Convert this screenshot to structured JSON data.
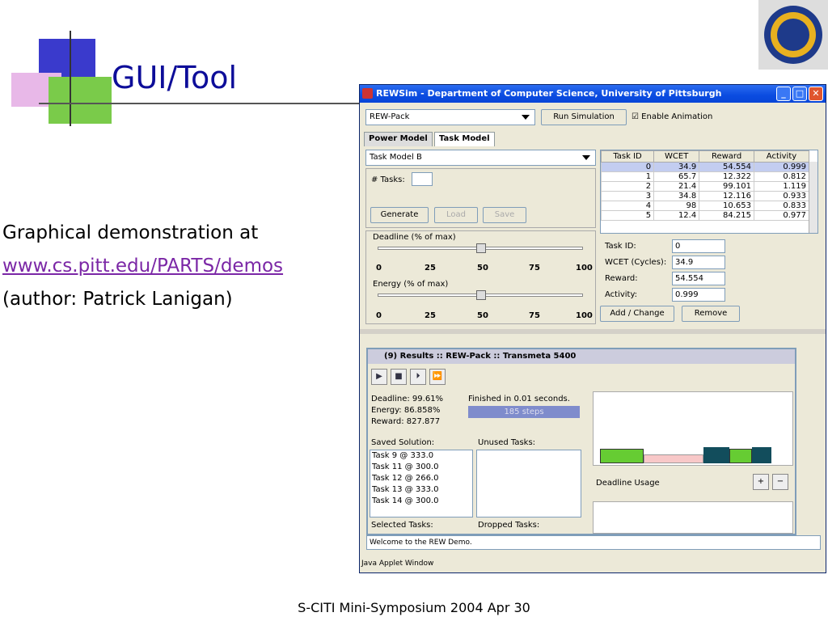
{
  "slide": {
    "title": "GUI/Tool",
    "line1": "Graphical demonstration at",
    "link": "www.cs.pitt.edu/PARTS/demos",
    "line3": "(author: Patrick Lanigan)",
    "footer": "S-CITI Mini-Symposium 2004 Apr 30"
  },
  "window": {
    "title": "REWSim - Department of Computer Science, University of Pittsburgh",
    "combo_value": "REW-Pack",
    "run_button": "Run Simulation",
    "enable_anim": "Enable Animation",
    "tabs": [
      "Power Model",
      "Task Model"
    ],
    "task_model_value": "Task Model B",
    "num_tasks_label": "# Tasks:",
    "generate": "Generate",
    "load": "Load",
    "save": "Save",
    "deadline_label": "Deadline (% of max)",
    "energy_label": "Energy (% of max)",
    "ticks": [
      "0",
      "25",
      "50",
      "75",
      "100"
    ],
    "table": {
      "headers": [
        "Task ID",
        "WCET",
        "Reward",
        "Activity"
      ],
      "rows": [
        [
          "0",
          "34.9",
          "54.554",
          "0.999"
        ],
        [
          "1",
          "65.7",
          "12.322",
          "0.812"
        ],
        [
          "2",
          "21.4",
          "99.101",
          "1.119"
        ],
        [
          "3",
          "34.8",
          "12.116",
          "0.933"
        ],
        [
          "4",
          "98",
          "10.653",
          "0.833"
        ],
        [
          "5",
          "12.4",
          "84.215",
          "0.977"
        ]
      ]
    },
    "form": {
      "task_id_label": "Task ID:",
      "task_id": "0",
      "wcet_label": "WCET (Cycles):",
      "wcet": "34.9",
      "reward_label": "Reward:",
      "reward": "54.554",
      "activity_label": "Activity:",
      "activity": "0.999",
      "add_change": "Add / Change",
      "remove": "Remove"
    },
    "results": {
      "title": "(9) Results :: REW-Pack :: Transmeta 5400",
      "deadline": "Deadline:  99.61%",
      "energy": "Energy:    86.858%",
      "reward": "Reward:   827.877",
      "finished": "Finished in 0.01 seconds.",
      "steps": "185 steps",
      "saved_label": "Saved Solution:",
      "unused_label": "Unused Tasks:",
      "saved": [
        "Task 9 @ 333.0",
        "Task 11 @ 300.0",
        "Task 12 @ 266.0",
        "Task 13 @ 333.0",
        "Task 14 @ 300.0"
      ],
      "selected_label": "Selected Tasks:",
      "dropped_label": "Dropped Tasks:",
      "chart_label": "Deadline Usage"
    },
    "status": "Welcome to the REW Demo.",
    "applet": "Java Applet Window"
  },
  "colors": {
    "title_blue": "#0d0d99",
    "link": "#7b27a6",
    "green": "#66cc33",
    "pink": "#f8c8c8",
    "teal": "#124d5c"
  }
}
